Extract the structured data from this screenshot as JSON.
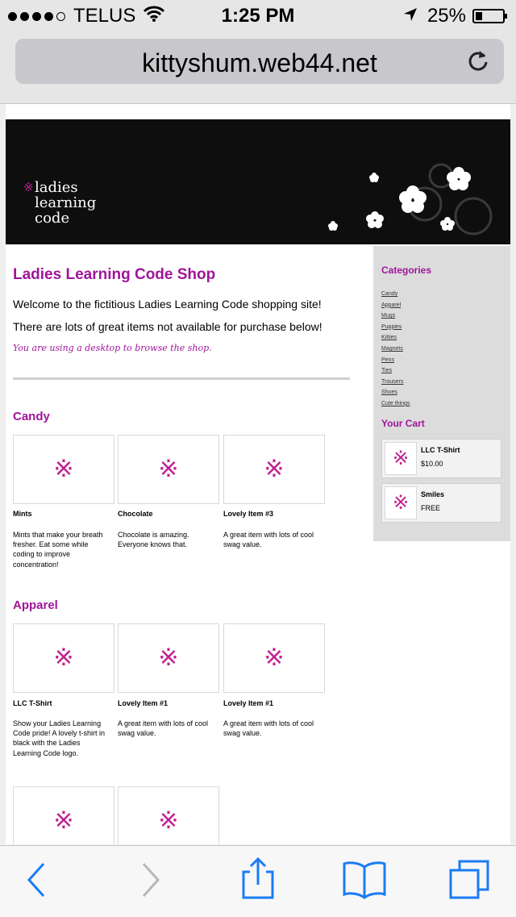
{
  "status_bar": {
    "carrier": "TELUS",
    "time": "1:25 PM",
    "battery": "25%",
    "signal_icon": "signal-dots-icon",
    "wifi_icon": "wifi-icon",
    "location_icon": "location-arrow-icon",
    "battery_icon": "battery-icon"
  },
  "browser": {
    "url": "kittyshum.web44.net",
    "reload_icon": "reload-icon"
  },
  "site": {
    "logo_lines": [
      "ladies",
      "learning",
      "code"
    ],
    "title": "Ladies Learning Code Shop",
    "welcome": "Welcome to the fictitious Ladies Learning Code shopping site!",
    "subtext": "There are lots of great items not available for purchase below!",
    "device_note": "You are using a desktop to browse the shop."
  },
  "sidebar": {
    "categories_heading": "Categories",
    "categories": [
      "Candy",
      "Apparel",
      "Mugs",
      "Puppies",
      "Kitties",
      "Magnets",
      "Pens",
      "Ties",
      "Trousers",
      "Shoes",
      "Cute things"
    ],
    "cart_heading": "Your Cart",
    "cart": [
      {
        "name": "LLC T-Shirt",
        "price": "$10.00"
      },
      {
        "name": "Smiles",
        "price": "FREE"
      }
    ]
  },
  "sections": [
    {
      "heading": "Candy",
      "products": [
        {
          "name": "Mints",
          "description": "Mints that make your breath fresher. Eat some while coding to improve concentration!"
        },
        {
          "name": "Chocolate",
          "description": "Chocolate is amazing. Everyone knows that."
        },
        {
          "name": "Lovely Item #3",
          "description": "A great item with lots of cool swag value."
        }
      ]
    },
    {
      "heading": "Apparel",
      "products": [
        {
          "name": "LLC T-Shirt",
          "description": "Show your Ladies Learning Code pride! A lovely t-shirt in black with the Ladies Learning Code logo."
        },
        {
          "name": "Lovely Item #1",
          "description": "A great item with lots of cool swag value."
        },
        {
          "name": "Lovely Item #1",
          "description": "A great item with lots of cool swag value."
        }
      ]
    }
  ],
  "colors": {
    "accent": "#a0149a",
    "logo_mark": "#c0208f",
    "ios_blue": "#1a7cf5",
    "banner": "#0e0e0e"
  },
  "toolbar": {
    "back_icon": "back-chevron-icon",
    "forward_icon": "forward-chevron-icon",
    "share_icon": "share-icon",
    "bookmarks_icon": "bookmarks-book-icon",
    "tabs_icon": "tabs-icon"
  }
}
